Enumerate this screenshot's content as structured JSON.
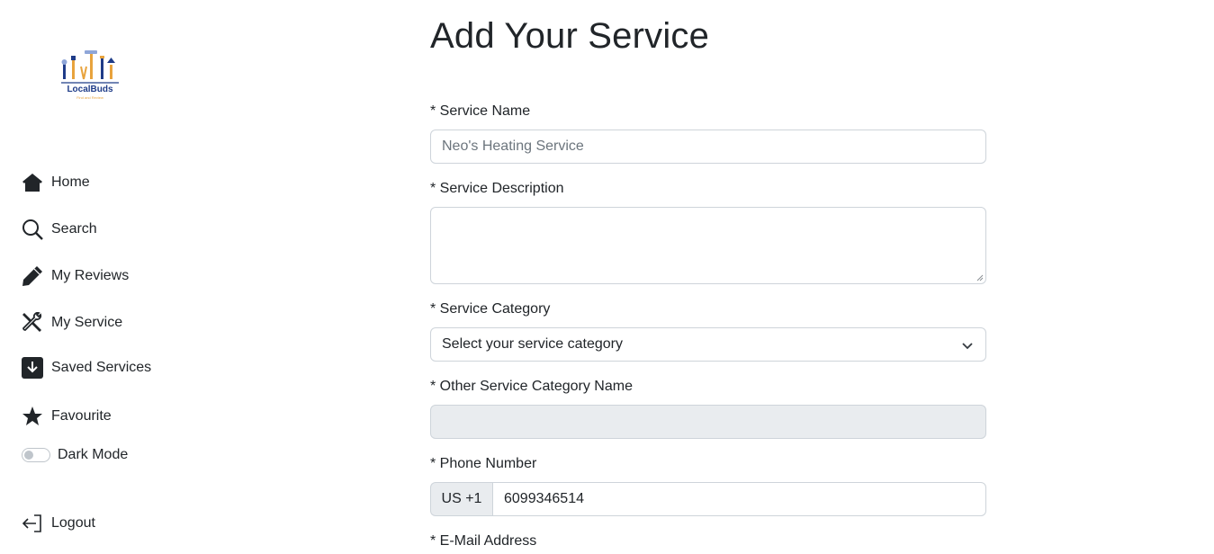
{
  "brand": {
    "name": "LocalBuds",
    "tagline": "Find and Review"
  },
  "sidebar": {
    "items": [
      {
        "label": "Home",
        "icon": "house-icon"
      },
      {
        "label": "Search",
        "icon": "search-icon"
      },
      {
        "label": "My Reviews",
        "icon": "pencil-icon"
      },
      {
        "label": "My Service",
        "icon": "tools-icon"
      },
      {
        "label": "Saved Services",
        "icon": "download-box-icon"
      },
      {
        "label": "Favourite",
        "icon": "star-icon"
      }
    ],
    "dark_mode_label": "Dark Mode",
    "logout_label": "Logout"
  },
  "form": {
    "title": "Add Your Service",
    "service_name": {
      "label": "* Service Name",
      "placeholder": "Neo's Heating Service"
    },
    "service_description": {
      "label": "* Service Description",
      "value": ""
    },
    "service_category": {
      "label": "* Service Category",
      "selected": "Select your service category"
    },
    "other_category": {
      "label": "* Other Service Category Name",
      "value": ""
    },
    "phone": {
      "label": "* Phone Number",
      "prefix": "US +1",
      "value": "6099346514"
    },
    "email": {
      "label": "* E-Mail Address"
    }
  },
  "colors": {
    "text": "#212529",
    "border": "#ced4da",
    "disabled_bg": "#e9ecef",
    "brand_blue": "#1f3c88",
    "brand_orange": "#e8a33d"
  }
}
